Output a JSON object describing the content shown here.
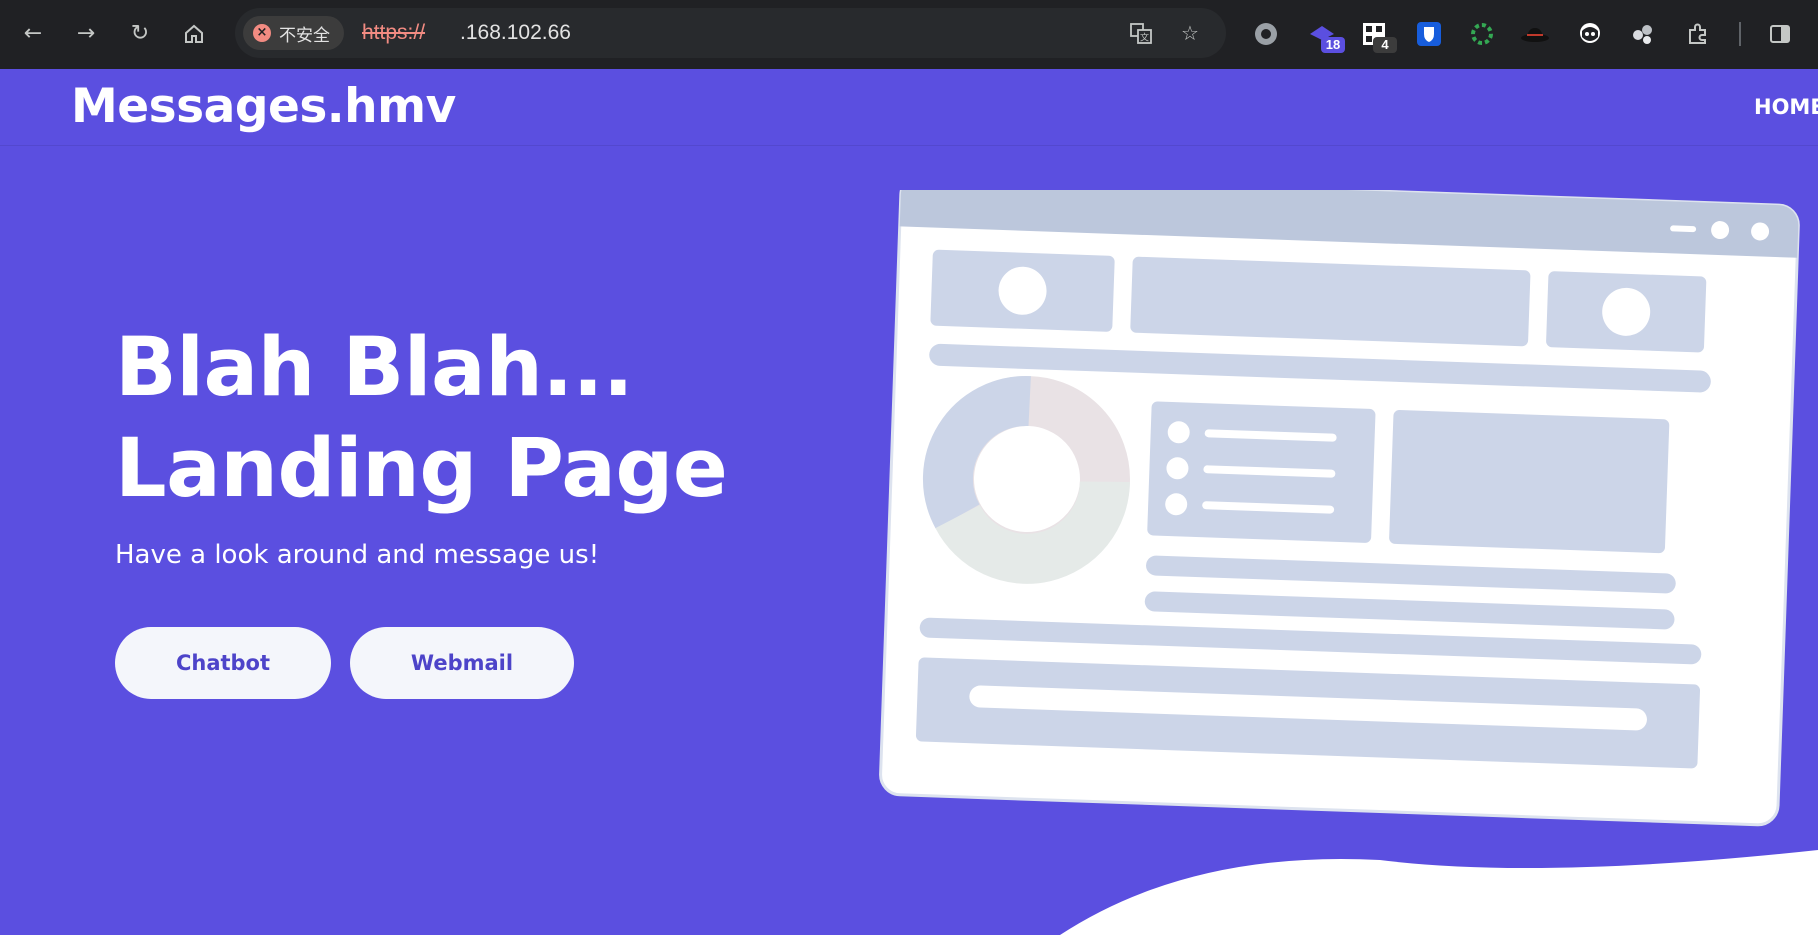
{
  "browser": {
    "security_label": "不安全",
    "url_scheme": "https://",
    "url_host": "      .168.102.66",
    "extension_badges": [
      "18",
      "4"
    ]
  },
  "site": {
    "brand": "Messages.hmv",
    "nav": [
      "HOME"
    ]
  },
  "hero": {
    "title_line1": "Blah Blah...",
    "title_line2": "Landing Page",
    "subtitle": "Have a look around and message us!",
    "buttons": [
      "Chatbot",
      "Webmail"
    ]
  },
  "colors": {
    "page_bg": "#5b4fe0",
    "chrome_bg": "#202124",
    "button_bg": "#f4f6fb",
    "button_text": "#4d44c9"
  },
  "icons": {
    "chrome": [
      "back-arrow-icon",
      "forward-arrow-icon",
      "reload-icon",
      "home-icon"
    ],
    "omnibox": [
      "not-secure-icon",
      "translate-icon",
      "bookmark-star-icon"
    ],
    "extensions": [
      "record-icon",
      "hat-icon",
      "qr-icon",
      "bitwarden-icon",
      "gear-icon",
      "fedora-icon",
      "hacker-icon",
      "sparkle-icon",
      "extensions-puzzle-icon",
      "side-panel-icon"
    ]
  }
}
